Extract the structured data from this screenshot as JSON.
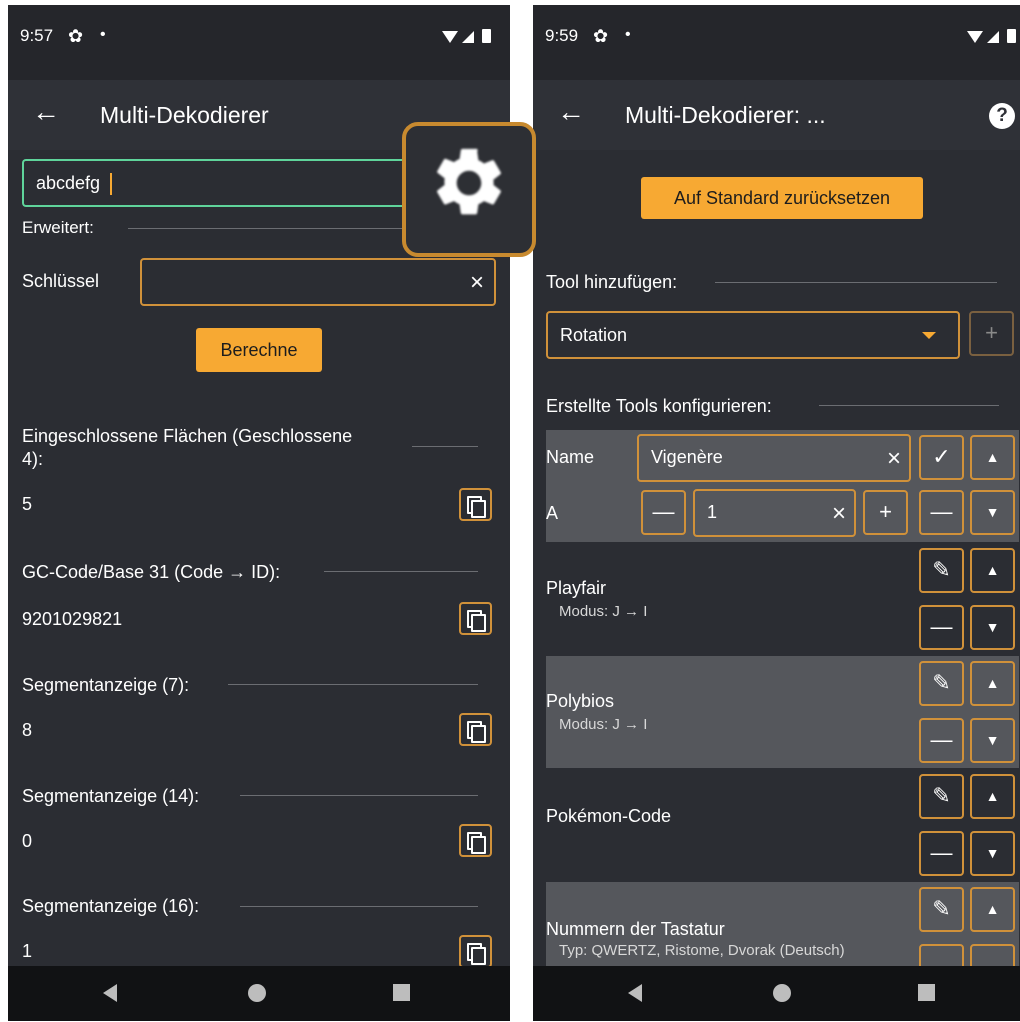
{
  "left": {
    "status": {
      "time": "9:57",
      "dot": "•"
    },
    "appbar": {
      "title": "Multi-Dekodierer",
      "back": "←"
    },
    "input_value": "abcdefg",
    "advanced_label": "Erweitert:",
    "key_label": "Schlüssel",
    "key_clear": "×",
    "calc_button": "Berechne",
    "results": [
      {
        "label": "Eingeschlossene Flächen (Geschlossene",
        "label2": "4):",
        "value": "5"
      },
      {
        "label": "GC-Code/Base 31 (Code → ID):",
        "value": "9201029821"
      },
      {
        "label": "Segmentanzeige (7):",
        "value": "8"
      },
      {
        "label": "Segmentanzeige (14):",
        "value": "0"
      },
      {
        "label": "Segmentanzeige (16):",
        "value": "1"
      }
    ]
  },
  "right": {
    "status": {
      "time": "9:59",
      "dot": "•"
    },
    "appbar": {
      "title": "Multi-Dekodierer: ...",
      "back": "←",
      "help": "?"
    },
    "reset_button": "Auf Standard zurücksetzen",
    "add_tool_label": "Tool hinzufügen:",
    "dropdown_value": "Rotation",
    "add_symbol": "+",
    "configure_label": "Erstellte Tools konfigurieren:",
    "editor": {
      "name_label": "Name",
      "name_value": "Vigenère",
      "param_label": "A",
      "param_value": "1",
      "clear": "×",
      "minus": "—",
      "plus": "+",
      "check": "✓"
    },
    "tools": [
      {
        "name": "Playfair",
        "detail": "Modus: J → I",
        "highlight": false
      },
      {
        "name": "Polybios",
        "detail": "Modus: J → I",
        "highlight": true
      },
      {
        "name": "Pokémon-Code",
        "detail": "",
        "highlight": false
      },
      {
        "name": "Nummern der Tastatur",
        "detail": "Typ: QWERTZ, Ristome, Dvorak (Deutsch)",
        "highlight": true
      }
    ]
  },
  "colors": {
    "accent": "#f7a933",
    "border": "#d0913a",
    "input_focus": "#5fd49b",
    "background": "#2b2d33"
  },
  "icons": [
    "settings-gear-icon",
    "help-icon",
    "back-arrow-icon",
    "copy-icon",
    "pencil-icon",
    "chevron-up-icon",
    "chevron-down-icon"
  ]
}
